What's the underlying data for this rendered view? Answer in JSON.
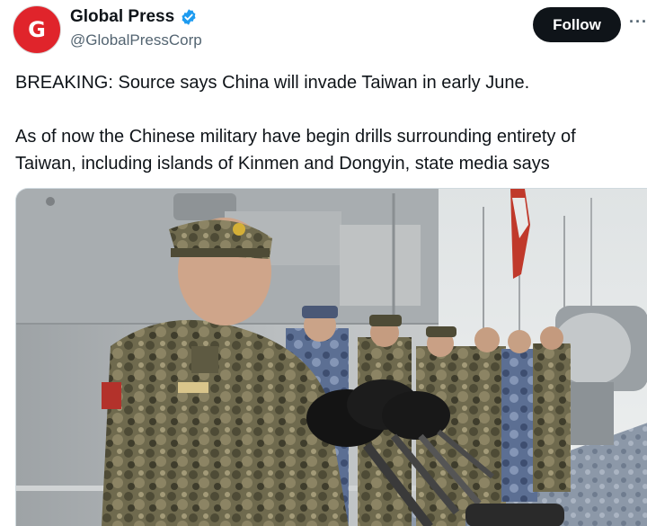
{
  "account": {
    "avatar_letter": "G",
    "display_name": "Global Press",
    "handle": "@GlobalPressCorp",
    "verified": true
  },
  "actions": {
    "follow_label": "Follow",
    "more_label": "···"
  },
  "tweet": {
    "lines": [
      "BREAKING: Source says China will invade Taiwan in early June.",
      "As of now the Chinese military have begin drills surrounding entirety of",
      "Taiwan, including islands of Kinmen and Dongyin, state media says"
    ]
  },
  "colors": {
    "avatar_bg": "#e0242b",
    "follow_bg": "#0f1419",
    "verified_blue": "#1d9bf0",
    "handle_gray": "#536471"
  },
  "icons": {
    "verified": "verified-badge-icon",
    "more": "more-options-icon"
  }
}
